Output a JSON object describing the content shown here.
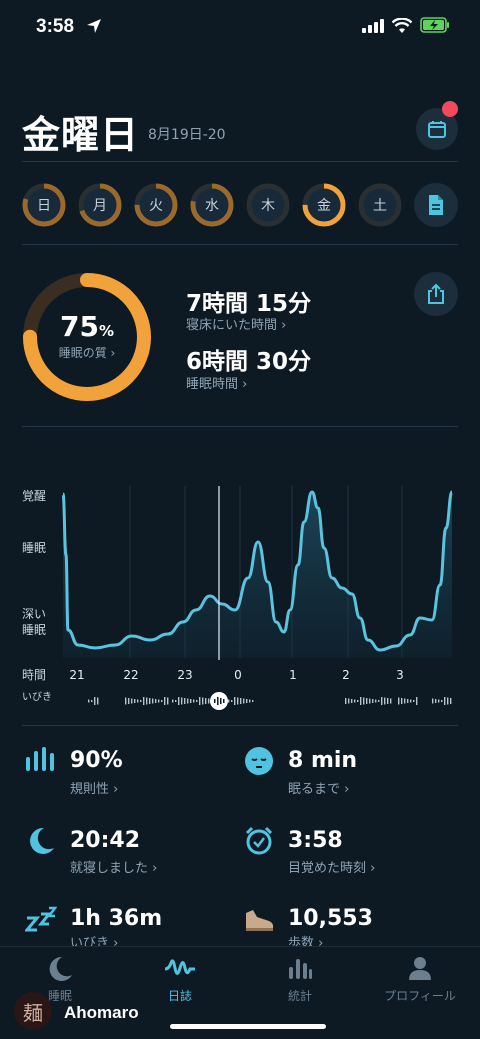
{
  "status": {
    "time": "3:58"
  },
  "header": {
    "title": "金曜日",
    "date": "8月19日-20"
  },
  "week": [
    {
      "label": "日",
      "score": 0.8,
      "color": "#9a6a2c"
    },
    {
      "label": "月",
      "score": 0.7,
      "color": "#9a6a2c"
    },
    {
      "label": "火",
      "score": 0.75,
      "color": "#9a6a2c"
    },
    {
      "label": "水",
      "score": 0.78,
      "color": "#9a6a2c"
    },
    {
      "label": "木",
      "score": 0,
      "color": "#9a6a2c"
    },
    {
      "label": "金",
      "score": 0.75,
      "color": "#f2a23a"
    },
    {
      "label": "土",
      "score": 0,
      "color": "#9a6a2c"
    }
  ],
  "quality": {
    "value": "75",
    "unit": "%",
    "fraction": 0.75,
    "label": "睡眠の質 ›"
  },
  "time_in_bed": {
    "value": "7時間 15分",
    "label": "寝床にいた時間 ›"
  },
  "sleep_time": {
    "value": "6時間 30分",
    "label": "睡眠時間 ›"
  },
  "chart_labels": {
    "awake": "覚醒",
    "sleep": "睡眠",
    "deep1": "深い",
    "deep2": "睡眠",
    "time": "時間",
    "snore": "いびき",
    "hours": [
      "21",
      "22",
      "23",
      "0",
      "1",
      "2",
      "3"
    ]
  },
  "metrics": {
    "regularity": {
      "value": "90%",
      "label": "規則性 ›"
    },
    "fall_asleep": {
      "value": "8 min",
      "label": "眠るまで ›"
    },
    "bedtime": {
      "value": "20:42",
      "label": "就寝しました ›"
    },
    "wakeup": {
      "value": "3:58",
      "label": "目覚めた時刻 ›"
    },
    "snoring": {
      "value": "1h 36m",
      "label": "いびき ›"
    },
    "steps": {
      "value": "10,553",
      "label": "歩数 ›"
    }
  },
  "tabs": {
    "sleep": "睡眠",
    "journal": "日誌",
    "stats": "統計",
    "profile": "プロフィール"
  },
  "user": {
    "name": "Ahomaro",
    "avatar_char": "麺"
  },
  "colors": {
    "accent": "#4fc3e0",
    "ring": "#f2a23a",
    "bg": "#0d1a24"
  }
}
